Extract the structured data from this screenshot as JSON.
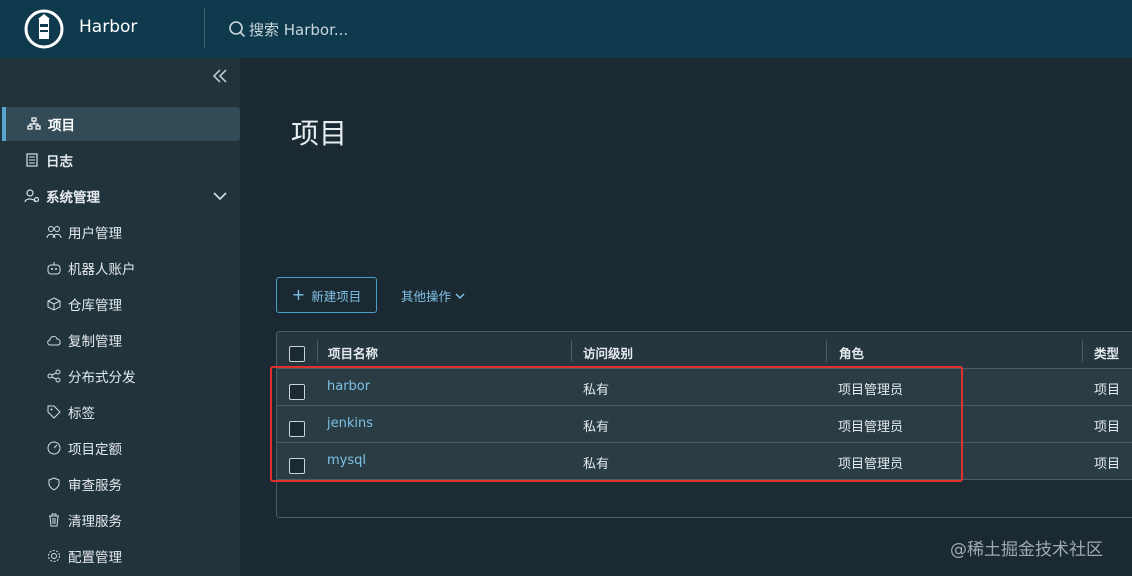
{
  "header": {
    "brand": "Harbor",
    "search_placeholder": "搜索 Harbor..."
  },
  "sidebar": {
    "items": [
      {
        "label": "项目",
        "icon": "project-icon",
        "active": true
      },
      {
        "label": "日志",
        "icon": "log-icon"
      },
      {
        "label": "系统管理",
        "icon": "admin-icon",
        "expanded": true
      }
    ],
    "sub_items": [
      {
        "label": "用户管理",
        "icon": "users-icon"
      },
      {
        "label": "机器人账户",
        "icon": "robot-icon"
      },
      {
        "label": "仓库管理",
        "icon": "cube-icon"
      },
      {
        "label": "复制管理",
        "icon": "cloud-icon"
      },
      {
        "label": "分布式分发",
        "icon": "share-icon"
      },
      {
        "label": "标签",
        "icon": "tag-icon"
      },
      {
        "label": "项目定额",
        "icon": "gauge-icon"
      },
      {
        "label": "审查服务",
        "icon": "shield-icon"
      },
      {
        "label": "清理服务",
        "icon": "trash-icon"
      },
      {
        "label": "配置管理",
        "icon": "gear-icon"
      }
    ]
  },
  "main": {
    "title": "项目",
    "new_button": "新建项目",
    "other_actions": "其他操作"
  },
  "table": {
    "columns": [
      "项目名称",
      "访问级别",
      "角色",
      "类型"
    ],
    "rows": [
      {
        "name": "harbor",
        "access": "私有",
        "role": "项目管理员",
        "type": "项目"
      },
      {
        "name": "jenkins",
        "access": "私有",
        "role": "项目管理员",
        "type": "项目"
      },
      {
        "name": "mysql",
        "access": "私有",
        "role": "项目管理员",
        "type": "项目"
      }
    ]
  },
  "watermark": "@稀土掘金技术社区",
  "colors": {
    "header_bg": "#0f3a4d",
    "sidebar_bg": "#21333b",
    "page_bg": "#1b2a32",
    "accent": "#7fc1e6",
    "highlight": "#e0322a"
  }
}
